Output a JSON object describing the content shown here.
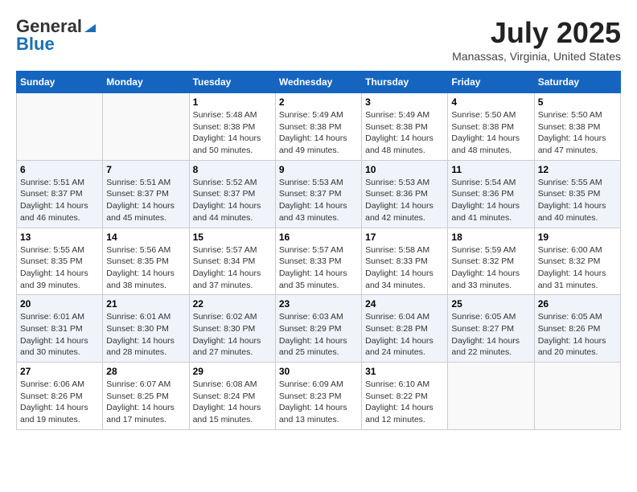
{
  "header": {
    "logo_general": "General",
    "logo_blue": "Blue",
    "month_title": "July 2025",
    "location": "Manassas, Virginia, United States"
  },
  "days_of_week": [
    "Sunday",
    "Monday",
    "Tuesday",
    "Wednesday",
    "Thursday",
    "Friday",
    "Saturday"
  ],
  "weeks": [
    [
      {
        "day": "",
        "sunrise": "",
        "sunset": "",
        "daylight": ""
      },
      {
        "day": "",
        "sunrise": "",
        "sunset": "",
        "daylight": ""
      },
      {
        "day": "1",
        "sunrise": "Sunrise: 5:48 AM",
        "sunset": "Sunset: 8:38 PM",
        "daylight": "Daylight: 14 hours and 50 minutes."
      },
      {
        "day": "2",
        "sunrise": "Sunrise: 5:49 AM",
        "sunset": "Sunset: 8:38 PM",
        "daylight": "Daylight: 14 hours and 49 minutes."
      },
      {
        "day": "3",
        "sunrise": "Sunrise: 5:49 AM",
        "sunset": "Sunset: 8:38 PM",
        "daylight": "Daylight: 14 hours and 48 minutes."
      },
      {
        "day": "4",
        "sunrise": "Sunrise: 5:50 AM",
        "sunset": "Sunset: 8:38 PM",
        "daylight": "Daylight: 14 hours and 48 minutes."
      },
      {
        "day": "5",
        "sunrise": "Sunrise: 5:50 AM",
        "sunset": "Sunset: 8:38 PM",
        "daylight": "Daylight: 14 hours and 47 minutes."
      }
    ],
    [
      {
        "day": "6",
        "sunrise": "Sunrise: 5:51 AM",
        "sunset": "Sunset: 8:37 PM",
        "daylight": "Daylight: 14 hours and 46 minutes."
      },
      {
        "day": "7",
        "sunrise": "Sunrise: 5:51 AM",
        "sunset": "Sunset: 8:37 PM",
        "daylight": "Daylight: 14 hours and 45 minutes."
      },
      {
        "day": "8",
        "sunrise": "Sunrise: 5:52 AM",
        "sunset": "Sunset: 8:37 PM",
        "daylight": "Daylight: 14 hours and 44 minutes."
      },
      {
        "day": "9",
        "sunrise": "Sunrise: 5:53 AM",
        "sunset": "Sunset: 8:37 PM",
        "daylight": "Daylight: 14 hours and 43 minutes."
      },
      {
        "day": "10",
        "sunrise": "Sunrise: 5:53 AM",
        "sunset": "Sunset: 8:36 PM",
        "daylight": "Daylight: 14 hours and 42 minutes."
      },
      {
        "day": "11",
        "sunrise": "Sunrise: 5:54 AM",
        "sunset": "Sunset: 8:36 PM",
        "daylight": "Daylight: 14 hours and 41 minutes."
      },
      {
        "day": "12",
        "sunrise": "Sunrise: 5:55 AM",
        "sunset": "Sunset: 8:35 PM",
        "daylight": "Daylight: 14 hours and 40 minutes."
      }
    ],
    [
      {
        "day": "13",
        "sunrise": "Sunrise: 5:55 AM",
        "sunset": "Sunset: 8:35 PM",
        "daylight": "Daylight: 14 hours and 39 minutes."
      },
      {
        "day": "14",
        "sunrise": "Sunrise: 5:56 AM",
        "sunset": "Sunset: 8:35 PM",
        "daylight": "Daylight: 14 hours and 38 minutes."
      },
      {
        "day": "15",
        "sunrise": "Sunrise: 5:57 AM",
        "sunset": "Sunset: 8:34 PM",
        "daylight": "Daylight: 14 hours and 37 minutes."
      },
      {
        "day": "16",
        "sunrise": "Sunrise: 5:57 AM",
        "sunset": "Sunset: 8:33 PM",
        "daylight": "Daylight: 14 hours and 35 minutes."
      },
      {
        "day": "17",
        "sunrise": "Sunrise: 5:58 AM",
        "sunset": "Sunset: 8:33 PM",
        "daylight": "Daylight: 14 hours and 34 minutes."
      },
      {
        "day": "18",
        "sunrise": "Sunrise: 5:59 AM",
        "sunset": "Sunset: 8:32 PM",
        "daylight": "Daylight: 14 hours and 33 minutes."
      },
      {
        "day": "19",
        "sunrise": "Sunrise: 6:00 AM",
        "sunset": "Sunset: 8:32 PM",
        "daylight": "Daylight: 14 hours and 31 minutes."
      }
    ],
    [
      {
        "day": "20",
        "sunrise": "Sunrise: 6:01 AM",
        "sunset": "Sunset: 8:31 PM",
        "daylight": "Daylight: 14 hours and 30 minutes."
      },
      {
        "day": "21",
        "sunrise": "Sunrise: 6:01 AM",
        "sunset": "Sunset: 8:30 PM",
        "daylight": "Daylight: 14 hours and 28 minutes."
      },
      {
        "day": "22",
        "sunrise": "Sunrise: 6:02 AM",
        "sunset": "Sunset: 8:30 PM",
        "daylight": "Daylight: 14 hours and 27 minutes."
      },
      {
        "day": "23",
        "sunrise": "Sunrise: 6:03 AM",
        "sunset": "Sunset: 8:29 PM",
        "daylight": "Daylight: 14 hours and 25 minutes."
      },
      {
        "day": "24",
        "sunrise": "Sunrise: 6:04 AM",
        "sunset": "Sunset: 8:28 PM",
        "daylight": "Daylight: 14 hours and 24 minutes."
      },
      {
        "day": "25",
        "sunrise": "Sunrise: 6:05 AM",
        "sunset": "Sunset: 8:27 PM",
        "daylight": "Daylight: 14 hours and 22 minutes."
      },
      {
        "day": "26",
        "sunrise": "Sunrise: 6:05 AM",
        "sunset": "Sunset: 8:26 PM",
        "daylight": "Daylight: 14 hours and 20 minutes."
      }
    ],
    [
      {
        "day": "27",
        "sunrise": "Sunrise: 6:06 AM",
        "sunset": "Sunset: 8:26 PM",
        "daylight": "Daylight: 14 hours and 19 minutes."
      },
      {
        "day": "28",
        "sunrise": "Sunrise: 6:07 AM",
        "sunset": "Sunset: 8:25 PM",
        "daylight": "Daylight: 14 hours and 17 minutes."
      },
      {
        "day": "29",
        "sunrise": "Sunrise: 6:08 AM",
        "sunset": "Sunset: 8:24 PM",
        "daylight": "Daylight: 14 hours and 15 minutes."
      },
      {
        "day": "30",
        "sunrise": "Sunrise: 6:09 AM",
        "sunset": "Sunset: 8:23 PM",
        "daylight": "Daylight: 14 hours and 13 minutes."
      },
      {
        "day": "31",
        "sunrise": "Sunrise: 6:10 AM",
        "sunset": "Sunset: 8:22 PM",
        "daylight": "Daylight: 14 hours and 12 minutes."
      },
      {
        "day": "",
        "sunrise": "",
        "sunset": "",
        "daylight": ""
      },
      {
        "day": "",
        "sunrise": "",
        "sunset": "",
        "daylight": ""
      }
    ]
  ]
}
